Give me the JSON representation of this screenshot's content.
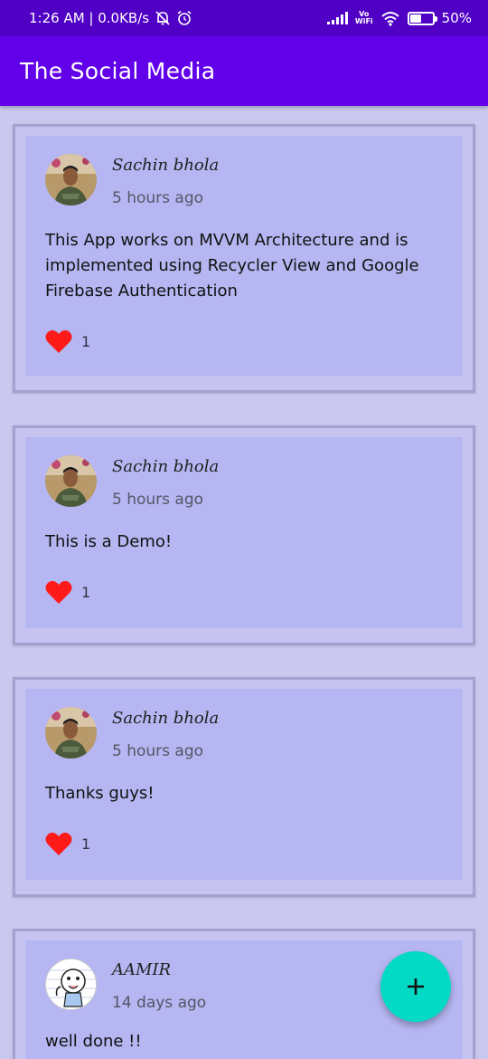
{
  "status_bar": {
    "time_info": "1:26 AM | 0.0KB/s",
    "vowifi_top": "Vo",
    "vowifi_bottom": "WiFi",
    "battery": "50%",
    "battery_level": 0.5
  },
  "app_bar": {
    "title": "The Social Media"
  },
  "posts": [
    {
      "author": "Sachin bhola",
      "time": "5 hours ago",
      "text": "This App works on MVVM Architecture and is implemented using Recycler View and Google Firebase Authentication",
      "likes": "1",
      "avatar": "profile-photo"
    },
    {
      "author": "Sachin bhola",
      "time": "5 hours ago",
      "text": "This is a Demo!",
      "likes": "1",
      "avatar": "profile-photo"
    },
    {
      "author": "Sachin bhola",
      "time": "5 hours ago",
      "text": "Thanks guys!",
      "likes": "1",
      "avatar": "profile-photo"
    },
    {
      "author": "AAMIR",
      "time": "14 days ago",
      "text": "well done !!",
      "likes": "",
      "avatar": "cartoon-avatar"
    }
  ],
  "fab": {
    "icon": "plus-icon",
    "color": "#03dac5"
  },
  "colors": {
    "status_bar": "#4f00c4",
    "app_bar": "#6200ea",
    "background": "#cbc8f0",
    "card_inner": "#b6b6f2",
    "like_heart": "#ff1a1a"
  }
}
